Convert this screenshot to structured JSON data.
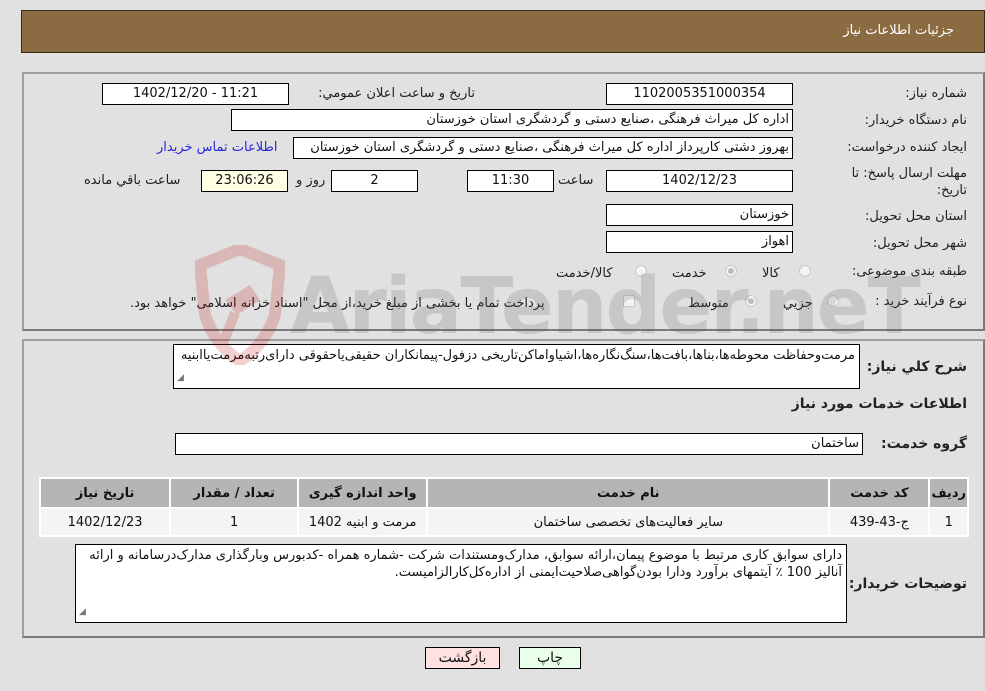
{
  "header": {
    "title": "جزئیات اطلاعات نیاز"
  },
  "form": {
    "need_number": {
      "label": "شماره نیاز:",
      "value": "1102005351000354"
    },
    "announce_datetime": {
      "label": "تاریخ و ساعت اعلان عمومي:",
      "value": "1402/12/20 - 11:21"
    },
    "buyer_org": {
      "label": "نام دستگاه خریدار:",
      "value": "اداره کل میراث فرهنگی ،صنایع دستی و گردشگری استان خوزستان"
    },
    "requester": {
      "label": "ایجاد کننده درخواست:",
      "value": "بهروز دشتی کارپرداز اداره کل میراث فرهنگی ،صنایع دستی و گردشگری استان خوزستان"
    },
    "buyer_contact_link": "اطلاعات تماس خریدار",
    "deadline": {
      "label": "مهلت ارسال پاسخ: تا تاریخ:",
      "date": "1402/12/23",
      "time_label": "ساعت",
      "time": "11:30",
      "days": "2",
      "days_label": "روز و",
      "remaining": "23:06:26",
      "remaining_label": "ساعت باقي مانده"
    },
    "province": {
      "label": "استان محل تحویل:",
      "value": "خوزستان"
    },
    "city": {
      "label": "شهر محل تحویل:",
      "value": "اهواز"
    },
    "category": {
      "label": "طبقه بندی موضوعی:",
      "options": [
        "کالا",
        "خدمت",
        "کالا/خدمت"
      ],
      "selected": "خدمت"
    },
    "process": {
      "label": "نوع فرآیند خرید :",
      "options": [
        "جزيي",
        "متوسط"
      ],
      "selected": "متوسط",
      "note": "پرداخت تمام یا بخشی از مبلغ خرید،از محل \"اسناد خزانه اسلامی\" خواهد بود."
    }
  },
  "details": {
    "description_label": "شرح کلي نياز:",
    "description": "مرمت‌وحفاظت محوطه‌ها،بناها،بافت‌ها،سنگ‌نگاره‌ها،اشیاواماکن‌تاریخی دزفول-پیمانکاران حقیقی‌یاحقوقی دارای‌رتبه‌مرمت‌یاابنیه",
    "services_title": "اطلاعات خدمات مورد نياز",
    "service_group_label": "گروه خدمت:",
    "service_group": "ساختمان",
    "table": {
      "headers": [
        "ردیف",
        "کد خدمت",
        "نام خدمت",
        "واحد اندازه گیری",
        "تعداد / مقدار",
        "تاریخ نیاز"
      ],
      "rows": [
        [
          "1",
          "ج-43-439",
          "سایر فعالیت‌های تخصصی ساختمان",
          "مرمت و ابنیه 1402",
          "1",
          "1402/12/23"
        ]
      ]
    },
    "buyer_notes_label": "توضیحات خریدار:",
    "buyer_notes": "دارای سوابق کاری مرتبط با موضوع پیمان،ارائه سوابق، مدارک‌ومستندات شرکت -شماره همراه -کدبورس وبارگذاری مدارک‌درسامانه و ارائه آنالیز 100 ٪ آیتمهای برآورد ودارا بودن‌گواهی‌صلاحیت‌ایمنی از اداره‌کل‌کارالزامیست."
  },
  "buttons": {
    "print": "چاپ",
    "back": "بازگشت"
  },
  "colors": {
    "header": "#8b6c42",
    "print_bg": "#eaffea",
    "back_bg": "#ffe1e1",
    "link": "#2626d9"
  },
  "watermark": "AriaTender.neT"
}
